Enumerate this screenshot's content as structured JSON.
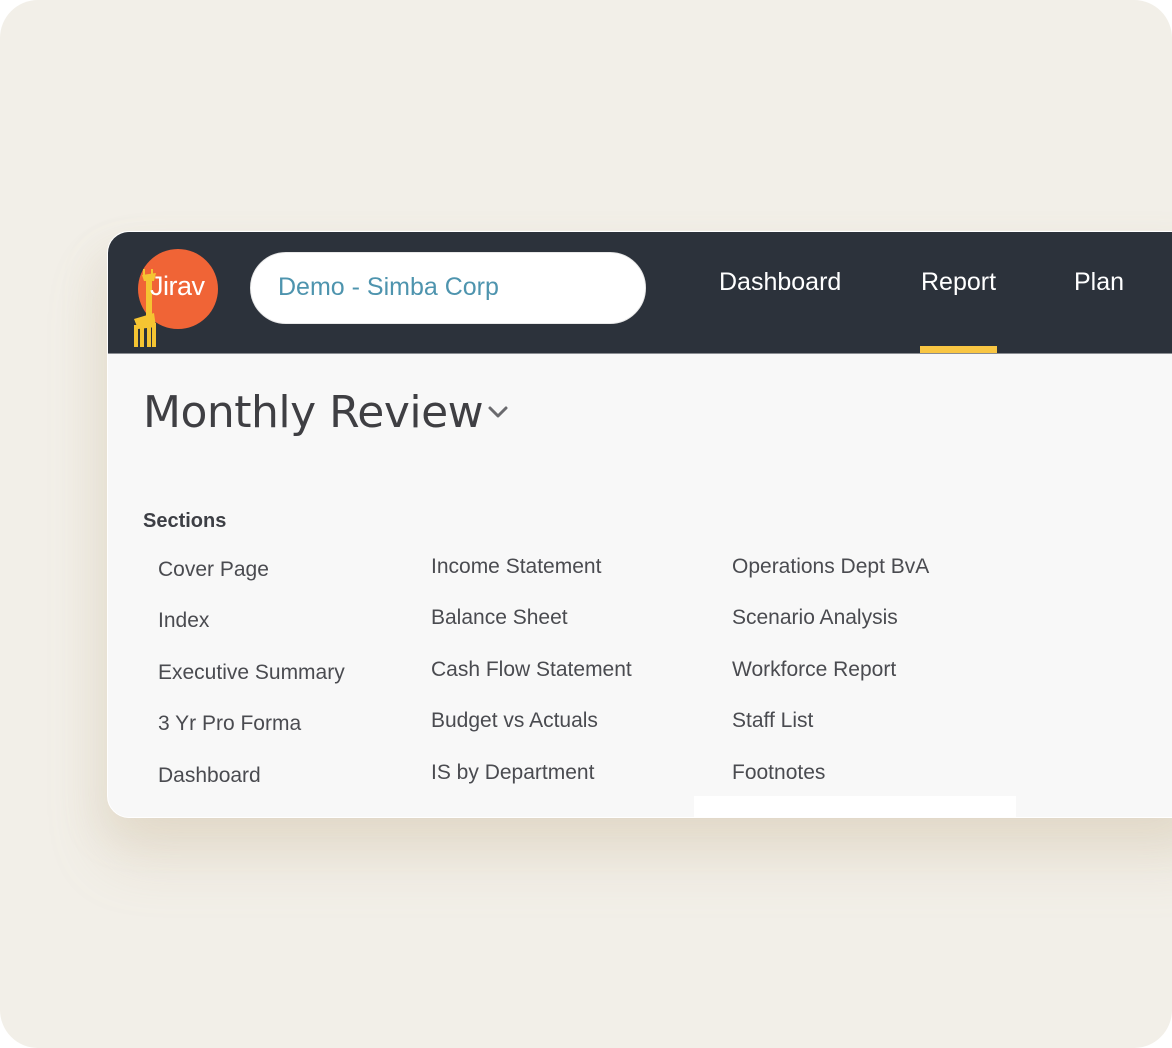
{
  "app": {
    "logo_text": "Jirav",
    "brand_color": "#f06436",
    "accent_color": "#f9c643",
    "topbar_color": "#2c323b"
  },
  "company_selector": {
    "value": "Demo - Simba Corp"
  },
  "nav": {
    "items": [
      {
        "label": "Dashboard",
        "active": false
      },
      {
        "label": "Report",
        "active": true
      },
      {
        "label": "Plan",
        "active": false
      }
    ]
  },
  "page": {
    "title": "Monthly Review",
    "sections_label": "Sections",
    "sections": [
      [
        "Cover Page",
        "Index",
        "Executive Summary",
        "3 Yr Pro Forma",
        "Dashboard"
      ],
      [
        "Income Statement",
        "Balance Sheet",
        "Cash Flow Statement",
        "Budget vs Actuals",
        "IS by Department"
      ],
      [
        "Operations Dept BvA",
        "Scenario Analysis",
        "Workforce Report",
        "Staff List",
        "Footnotes"
      ]
    ]
  }
}
